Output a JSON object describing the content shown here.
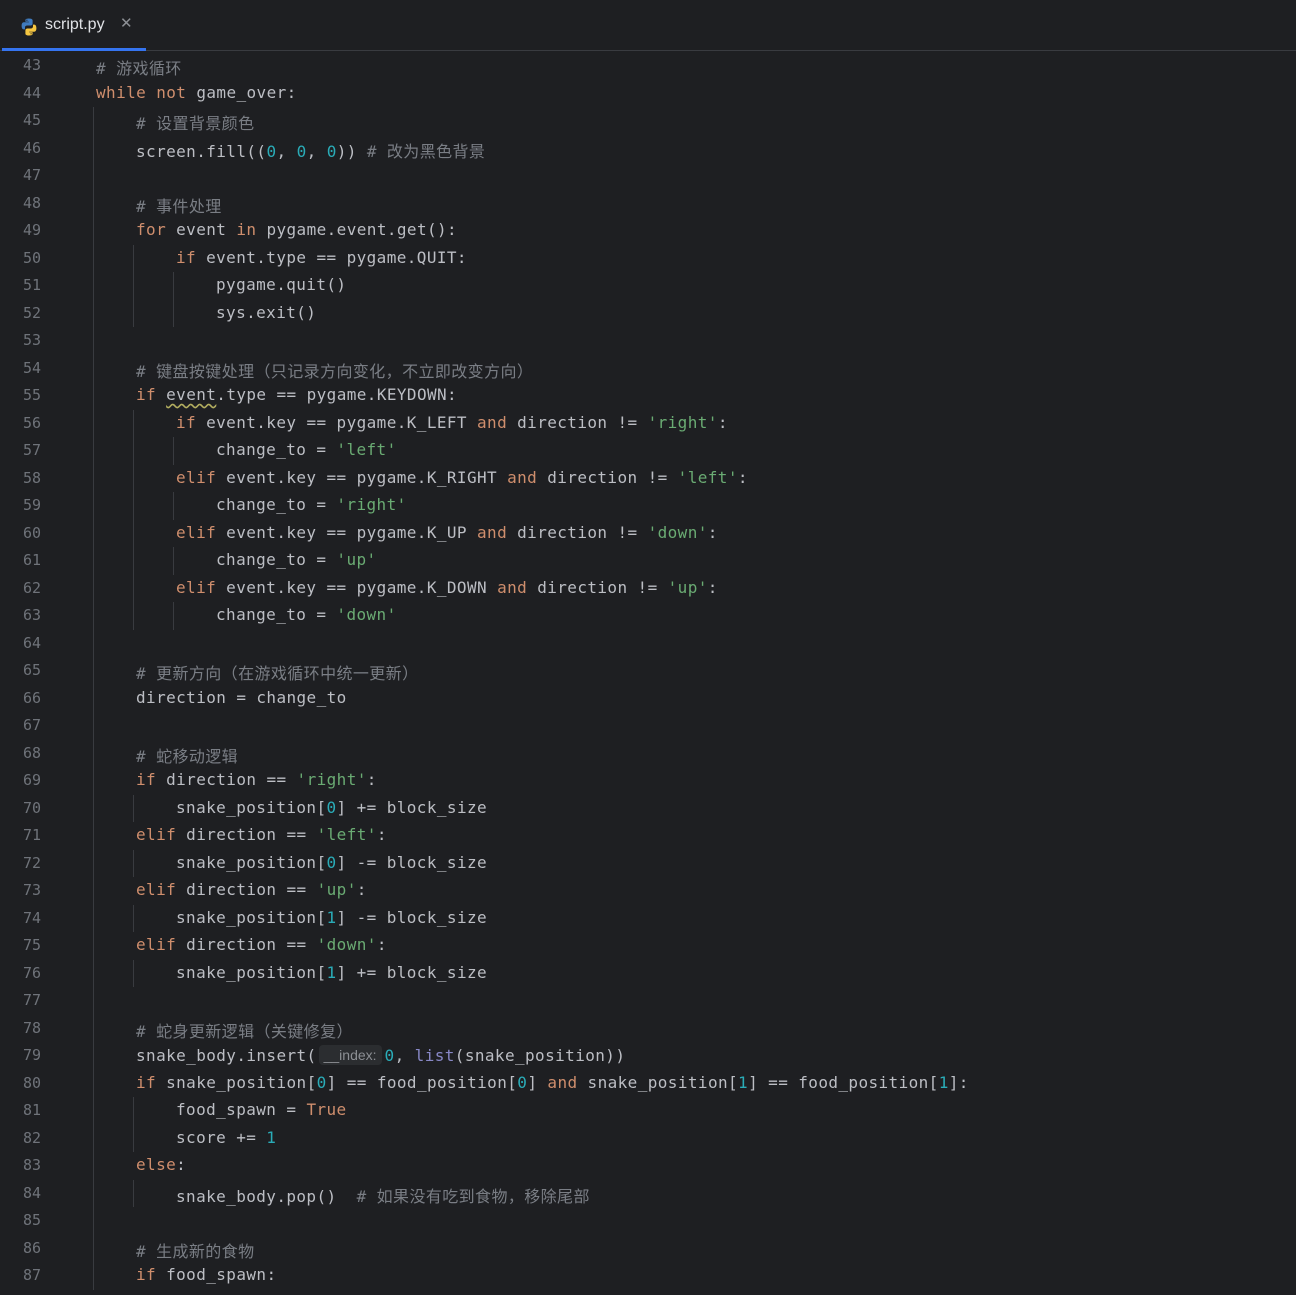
{
  "tab": {
    "filename": "script.py",
    "icon": "python-icon",
    "close_glyph": "✕"
  },
  "colors": {
    "background": "#1e1f22",
    "keyword": "#cf8e6d",
    "string": "#6aab73",
    "number": "#2aacb8",
    "comment": "#7a7e85",
    "builtin": "#8888c6",
    "text": "#bcbec4",
    "tab_accent": "#3574f0"
  },
  "code": {
    "first_line": 43,
    "lines": [
      {
        "indent": 0,
        "tokens": [
          {
            "c": "cmt",
            "t": "# 游戏循环"
          }
        ]
      },
      {
        "indent": 0,
        "tokens": [
          {
            "c": "kw",
            "t": "while"
          },
          {
            "t": " "
          },
          {
            "c": "kw",
            "t": "not"
          },
          {
            "t": " game_over:"
          }
        ]
      },
      {
        "indent": 1,
        "tokens": [
          {
            "c": "cmt",
            "t": "# 设置背景颜色"
          }
        ]
      },
      {
        "indent": 1,
        "tokens": [
          {
            "t": "screen.fill(("
          },
          {
            "c": "num",
            "t": "0"
          },
          {
            "t": ", "
          },
          {
            "c": "num",
            "t": "0"
          },
          {
            "t": ", "
          },
          {
            "c": "num",
            "t": "0"
          },
          {
            "t": ")) "
          },
          {
            "c": "cmt",
            "t": "# 改为黑色背景"
          }
        ]
      },
      {
        "indent": 1,
        "tokens": []
      },
      {
        "indent": 1,
        "tokens": [
          {
            "c": "cmt",
            "t": "# 事件处理"
          }
        ]
      },
      {
        "indent": 1,
        "tokens": [
          {
            "c": "kw",
            "t": "for"
          },
          {
            "t": " event "
          },
          {
            "c": "kw",
            "t": "in"
          },
          {
            "t": " pygame.event.get():"
          }
        ]
      },
      {
        "indent": 2,
        "tokens": [
          {
            "c": "kw",
            "t": "if"
          },
          {
            "t": " event.type == pygame.QUIT:"
          }
        ]
      },
      {
        "indent": 3,
        "tokens": [
          {
            "t": "pygame.quit()"
          }
        ]
      },
      {
        "indent": 3,
        "tokens": [
          {
            "t": "sys.exit()"
          }
        ]
      },
      {
        "indent": 1,
        "tokens": []
      },
      {
        "indent": 1,
        "tokens": [
          {
            "c": "cmt",
            "t": "# 键盘按键处理（只记录方向变化，不立即改变方向）"
          }
        ]
      },
      {
        "indent": 1,
        "tokens": [
          {
            "c": "kw",
            "t": "if"
          },
          {
            "t": " "
          },
          {
            "c": "warn",
            "t": "event"
          },
          {
            "t": ".type == pygame.KEYDOWN:"
          }
        ]
      },
      {
        "indent": 2,
        "tokens": [
          {
            "c": "kw",
            "t": "if"
          },
          {
            "t": " event.key == pygame.K_LEFT "
          },
          {
            "c": "kw",
            "t": "and"
          },
          {
            "t": " direction != "
          },
          {
            "c": "str",
            "t": "'right'"
          },
          {
            "t": ":"
          }
        ]
      },
      {
        "indent": 3,
        "tokens": [
          {
            "t": "change_to = "
          },
          {
            "c": "str",
            "t": "'left'"
          }
        ]
      },
      {
        "indent": 2,
        "tokens": [
          {
            "c": "kw",
            "t": "elif"
          },
          {
            "t": " event.key == pygame.K_RIGHT "
          },
          {
            "c": "kw",
            "t": "and"
          },
          {
            "t": " direction != "
          },
          {
            "c": "str",
            "t": "'left'"
          },
          {
            "t": ":"
          }
        ]
      },
      {
        "indent": 3,
        "tokens": [
          {
            "t": "change_to = "
          },
          {
            "c": "str",
            "t": "'right'"
          }
        ]
      },
      {
        "indent": 2,
        "tokens": [
          {
            "c": "kw",
            "t": "elif"
          },
          {
            "t": " event.key == pygame.K_UP "
          },
          {
            "c": "kw",
            "t": "and"
          },
          {
            "t": " direction != "
          },
          {
            "c": "str",
            "t": "'down'"
          },
          {
            "t": ":"
          }
        ]
      },
      {
        "indent": 3,
        "tokens": [
          {
            "t": "change_to = "
          },
          {
            "c": "str",
            "t": "'up'"
          }
        ]
      },
      {
        "indent": 2,
        "tokens": [
          {
            "c": "kw",
            "t": "elif"
          },
          {
            "t": " event.key == pygame.K_DOWN "
          },
          {
            "c": "kw",
            "t": "and"
          },
          {
            "t": " direction != "
          },
          {
            "c": "str",
            "t": "'up'"
          },
          {
            "t": ":"
          }
        ]
      },
      {
        "indent": 3,
        "tokens": [
          {
            "t": "change_to = "
          },
          {
            "c": "str",
            "t": "'down'"
          }
        ]
      },
      {
        "indent": 1,
        "tokens": []
      },
      {
        "indent": 1,
        "tokens": [
          {
            "c": "cmt",
            "t": "# 更新方向（在游戏循环中统一更新）"
          }
        ]
      },
      {
        "indent": 1,
        "tokens": [
          {
            "t": "direction = change_to"
          }
        ]
      },
      {
        "indent": 1,
        "tokens": []
      },
      {
        "indent": 1,
        "tokens": [
          {
            "c": "cmt",
            "t": "# 蛇移动逻辑"
          }
        ]
      },
      {
        "indent": 1,
        "tokens": [
          {
            "c": "kw",
            "t": "if"
          },
          {
            "t": " direction == "
          },
          {
            "c": "str",
            "t": "'right'"
          },
          {
            "t": ":"
          }
        ]
      },
      {
        "indent": 2,
        "tokens": [
          {
            "t": "snake_position["
          },
          {
            "c": "num",
            "t": "0"
          },
          {
            "t": "] += block_size"
          }
        ]
      },
      {
        "indent": 1,
        "tokens": [
          {
            "c": "kw",
            "t": "elif"
          },
          {
            "t": " direction == "
          },
          {
            "c": "str",
            "t": "'left'"
          },
          {
            "t": ":"
          }
        ]
      },
      {
        "indent": 2,
        "tokens": [
          {
            "t": "snake_position["
          },
          {
            "c": "num",
            "t": "0"
          },
          {
            "t": "] -= block_size"
          }
        ]
      },
      {
        "indent": 1,
        "tokens": [
          {
            "c": "kw",
            "t": "elif"
          },
          {
            "t": " direction == "
          },
          {
            "c": "str",
            "t": "'up'"
          },
          {
            "t": ":"
          }
        ]
      },
      {
        "indent": 2,
        "tokens": [
          {
            "t": "snake_position["
          },
          {
            "c": "num",
            "t": "1"
          },
          {
            "t": "] -= block_size"
          }
        ]
      },
      {
        "indent": 1,
        "tokens": [
          {
            "c": "kw",
            "t": "elif"
          },
          {
            "t": " direction == "
          },
          {
            "c": "str",
            "t": "'down'"
          },
          {
            "t": ":"
          }
        ]
      },
      {
        "indent": 2,
        "tokens": [
          {
            "t": "snake_position["
          },
          {
            "c": "num",
            "t": "1"
          },
          {
            "t": "] += block_size"
          }
        ]
      },
      {
        "indent": 1,
        "tokens": []
      },
      {
        "indent": 1,
        "tokens": [
          {
            "c": "cmt",
            "t": "# 蛇身更新逻辑（关键修复）"
          }
        ]
      },
      {
        "indent": 1,
        "tokens": [
          {
            "t": "snake_body.insert("
          },
          {
            "c": "hint",
            "t": "__index:"
          },
          {
            "c": "num",
            "t": "0"
          },
          {
            "t": ", "
          },
          {
            "c": "bi",
            "t": "list"
          },
          {
            "t": "(snake_position))"
          }
        ]
      },
      {
        "indent": 1,
        "tokens": [
          {
            "c": "kw",
            "t": "if"
          },
          {
            "t": " snake_position["
          },
          {
            "c": "num",
            "t": "0"
          },
          {
            "t": "] == food_position["
          },
          {
            "c": "num",
            "t": "0"
          },
          {
            "t": "] "
          },
          {
            "c": "kw",
            "t": "and"
          },
          {
            "t": " snake_position["
          },
          {
            "c": "num",
            "t": "1"
          },
          {
            "t": "] == food_position["
          },
          {
            "c": "num",
            "t": "1"
          },
          {
            "t": "]:"
          }
        ]
      },
      {
        "indent": 2,
        "tokens": [
          {
            "t": "food_spawn = "
          },
          {
            "c": "kw",
            "t": "True"
          }
        ]
      },
      {
        "indent": 2,
        "tokens": [
          {
            "t": "score += "
          },
          {
            "c": "num",
            "t": "1"
          }
        ]
      },
      {
        "indent": 1,
        "tokens": [
          {
            "c": "kw",
            "t": "else"
          },
          {
            "t": ":"
          }
        ]
      },
      {
        "indent": 2,
        "tokens": [
          {
            "t": "snake_body.pop()  "
          },
          {
            "c": "cmt",
            "t": "# 如果没有吃到食物，移除尾部"
          }
        ]
      },
      {
        "indent": 1,
        "tokens": []
      },
      {
        "indent": 1,
        "tokens": [
          {
            "c": "cmt",
            "t": "# 生成新的食物"
          }
        ]
      },
      {
        "indent": 1,
        "tokens": [
          {
            "c": "kw",
            "t": "if"
          },
          {
            "t": " food_spawn:"
          }
        ]
      }
    ]
  }
}
